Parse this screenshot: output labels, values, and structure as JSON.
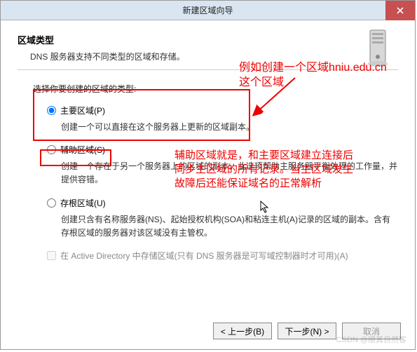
{
  "window": {
    "title": "新建区域向导",
    "heading": "区域类型",
    "subheading": "DNS 服务器支持不同类型的区域和存储。",
    "prompt": "选择你要创建的区域的类型:"
  },
  "options": {
    "primary": {
      "label": "主要区域(P)",
      "desc": "创建一个可以直接在这个服务器上更新的区域副本。"
    },
    "secondary": {
      "label": "辅助区域(S)",
      "desc": "创建一个存在于另一个服务器上的区域的副本。此选项帮助主服务器平衡处理的工作量，并提供容错。"
    },
    "stub": {
      "label": "存根区域(U)",
      "desc": "创建只含有名称服务器(NS)、起始授权机构(SOA)和粘连主机(A)记录的区域的副本。含有存根区域的服务器对该区域没有主管权。"
    }
  },
  "checkbox": {
    "label": "在 Active Directory 中存储区域(只有 DNS 服务器是可写域控制器时才可用)(A)"
  },
  "buttons": {
    "back": "< 上一步(B)",
    "next": "下一步(N) >",
    "cancel": "取消"
  },
  "annotations": {
    "a1_line1": "例如创建一个区域hniu.edu.cn",
    "a1_line2": "这个区域",
    "a2_line1": "辅助区域就是，和主要区域建立连接后",
    "a2_line2": "同步主区域的所有记录。当主区域发生",
    "a2_line3": "故障后还能保证域名的正常解析"
  },
  "watermark": "CSDN @顺其自然客"
}
